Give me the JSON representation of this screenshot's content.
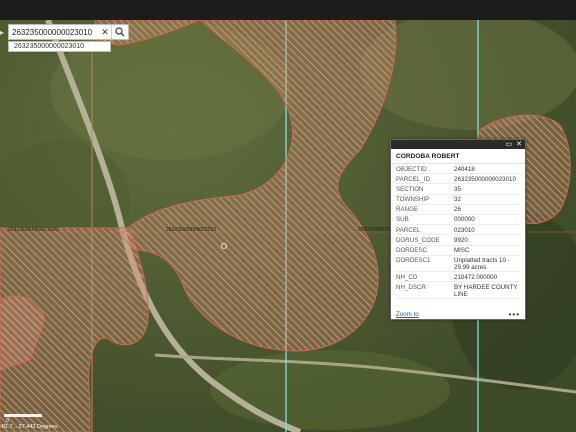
{
  "search": {
    "value": "263235000000023010",
    "clear_glyph": "✕",
    "suggestion": "263235000000023010"
  },
  "popup": {
    "title": "CORDOBA ROBERT",
    "window_icons": [
      "maximize-icon",
      "close-icon"
    ],
    "fields": [
      {
        "key": "OBJECTID",
        "value": "240418"
      },
      {
        "key": "PARCEL_ID",
        "value": "263235000000023010"
      },
      {
        "key": "SECTION",
        "value": "35"
      },
      {
        "key": "TOWNSHIP",
        "value": "32"
      },
      {
        "key": "RANGE",
        "value": "26"
      },
      {
        "key": "SUB",
        "value": "000000"
      },
      {
        "key": "PARCEL",
        "value": "023010"
      },
      {
        "key": "DORUS_CODE",
        "value": "9920"
      },
      {
        "key": "DORDESC",
        "value": "MISC"
      },
      {
        "key": "DORDESC1",
        "value": "Unplatted tracts 10 - 29.99 acres"
      },
      {
        "key": "NH_CD",
        "value": "210472.000000"
      },
      {
        "key": "NH_DSCR",
        "value": "BY HARDEE COUNTY LINE"
      }
    ],
    "zoom_link": "Zoom to",
    "more_glyph": "•••"
  },
  "map_labels": [
    "263235000000021020",
    "263235000000023010",
    "263235000000..."
  ],
  "status": {
    "coords": "-81.7... 27.442 Degrees",
    "scale_label": "0"
  },
  "colors": {
    "parcel_fill": "#d9826b",
    "parcel_stroke": "#c65a3e",
    "parcel_line": "#7fe0e0",
    "topbar": "#1c1c1c"
  }
}
